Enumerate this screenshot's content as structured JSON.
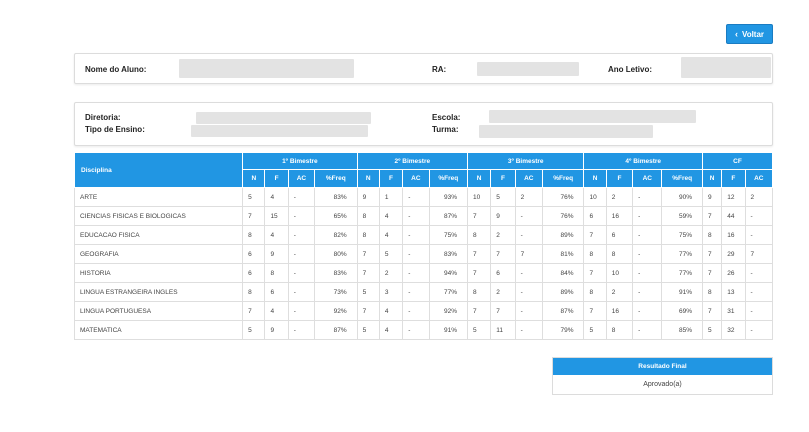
{
  "colors": {
    "accent": "#2196e3",
    "placeholder": "#e3e3e3"
  },
  "back_button": {
    "icon": "chevron-left-icon",
    "label": "Voltar"
  },
  "student_info": {
    "name_label": "Nome do Aluno:",
    "ra_label": "RA:",
    "year_label": "Ano Letivo:"
  },
  "school_info": {
    "directorate_label": "Diretoria:",
    "teaching_type_label": "Tipo de Ensino:",
    "school_label": "Escola:",
    "class_label": "Turma:"
  },
  "grades_table": {
    "subject_header": "Disciplina",
    "groups": [
      "1º Bimestre",
      "2º Bimestre",
      "3º Bimestre",
      "4º Bimestre",
      "CF"
    ],
    "subheaders": [
      "N",
      "F",
      "AC",
      "%Freq",
      "N",
      "F",
      "AC",
      "%Freq",
      "N",
      "F",
      "AC",
      "%Freq",
      "N",
      "F",
      "AC",
      "%Freq",
      "N",
      "F",
      "AC"
    ],
    "rows": [
      {
        "subject": "ARTE",
        "cells": [
          "5",
          "4",
          "-",
          "83%",
          "9",
          "1",
          "-",
          "93%",
          "10",
          "5",
          "2",
          "76%",
          "10",
          "2",
          "-",
          "90%",
          "9",
          "12",
          "2"
        ]
      },
      {
        "subject": "CIENCIAS FISICAS E BIOLOGICAS",
        "cells": [
          "7",
          "15",
          "-",
          "65%",
          "8",
          "4",
          "-",
          "87%",
          "7",
          "9",
          "-",
          "76%",
          "6",
          "16",
          "-",
          "59%",
          "7",
          "44",
          "-"
        ]
      },
      {
        "subject": "EDUCACAO FISICA",
        "cells": [
          "8",
          "4",
          "-",
          "82%",
          "8",
          "4",
          "-",
          "75%",
          "8",
          "2",
          "-",
          "89%",
          "7",
          "6",
          "-",
          "75%",
          "8",
          "16",
          "-"
        ]
      },
      {
        "subject": "GEOGRAFIA",
        "cells": [
          "6",
          "9",
          "-",
          "80%",
          "7",
          "5",
          "-",
          "83%",
          "7",
          "7",
          "7",
          "81%",
          "8",
          "8",
          "-",
          "77%",
          "7",
          "29",
          "7"
        ]
      },
      {
        "subject": "HISTORIA",
        "cells": [
          "6",
          "8",
          "-",
          "83%",
          "7",
          "2",
          "-",
          "94%",
          "7",
          "6",
          "-",
          "84%",
          "7",
          "10",
          "-",
          "77%",
          "7",
          "26",
          "-"
        ]
      },
      {
        "subject": "LINGUA ESTRANGEIRA INGLES",
        "cells": [
          "8",
          "6",
          "-",
          "73%",
          "5",
          "3",
          "-",
          "77%",
          "8",
          "2",
          "-",
          "89%",
          "8",
          "2",
          "-",
          "91%",
          "8",
          "13",
          "-"
        ]
      },
      {
        "subject": "LINGUA PORTUGUESA",
        "cells": [
          "7",
          "4",
          "-",
          "92%",
          "7",
          "4",
          "-",
          "92%",
          "7",
          "7",
          "-",
          "87%",
          "7",
          "16",
          "-",
          "69%",
          "7",
          "31",
          "-"
        ]
      },
      {
        "subject": "MATEMATICA",
        "cells": [
          "5",
          "9",
          "-",
          "87%",
          "5",
          "4",
          "-",
          "91%",
          "5",
          "11",
          "-",
          "79%",
          "5",
          "8",
          "-",
          "85%",
          "5",
          "32",
          "-"
        ]
      }
    ]
  },
  "final_result": {
    "header": "Resultado Final",
    "value": "Aprovado(a)"
  }
}
